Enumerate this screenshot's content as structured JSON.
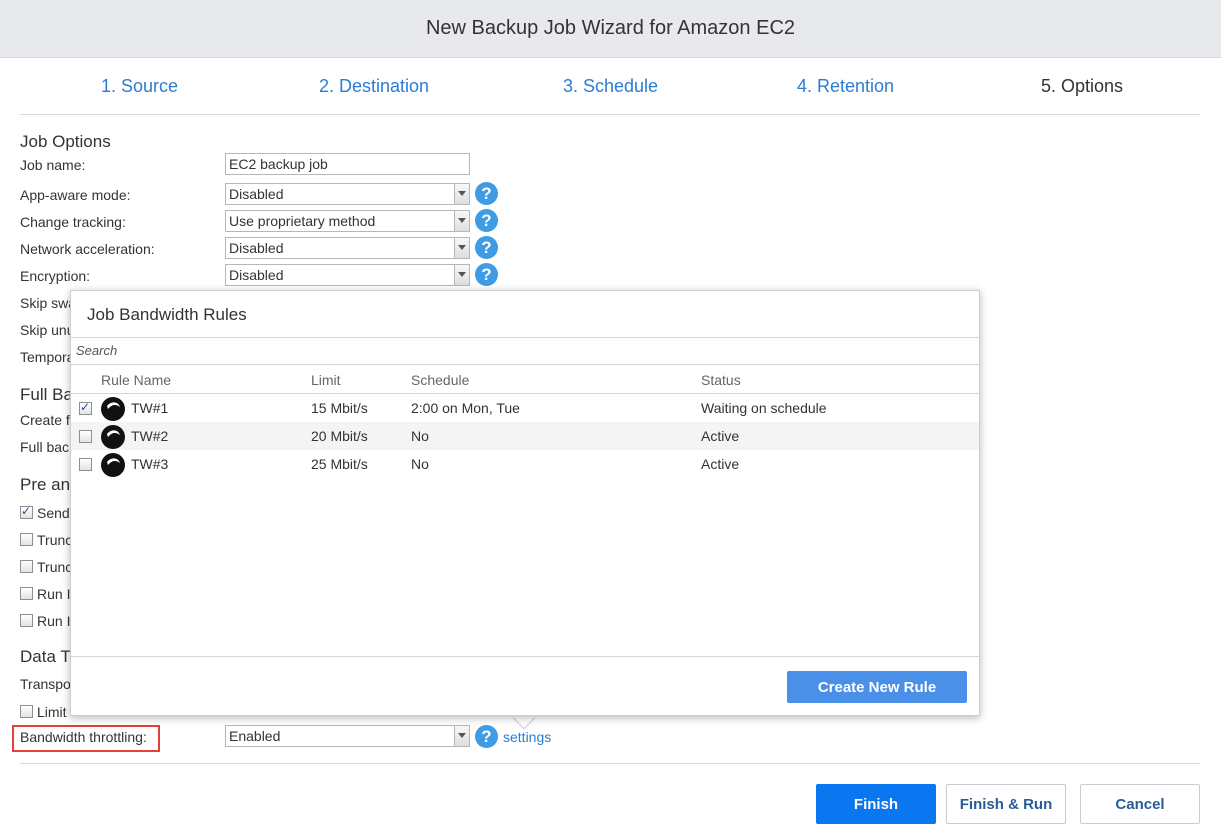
{
  "window": {
    "title": "New Backup Job Wizard for Amazon EC2"
  },
  "steps": [
    "1. Source",
    "2. Destination",
    "3. Schedule",
    "4. Retention",
    "5. Options"
  ],
  "job_options": {
    "title": "Job Options",
    "job_name_label": "Job name:",
    "job_name_value": "EC2 backup job",
    "app_aware_label": "App-aware mode:",
    "app_aware_value": "Disabled",
    "change_tracking_label": "Change tracking:",
    "change_tracking_value": "Use proprietary method",
    "network_accel_label": "Network acceleration:",
    "network_accel_value": "Disabled",
    "encryption_label": "Encryption:",
    "encryption_value": "Disabled",
    "skip_swap_label": "Skip swa",
    "skip_unused_label": "Skip unu",
    "temporary_label": "Tempora"
  },
  "full_backup": {
    "title": "Full Ba",
    "create_label": "Create f",
    "full_backup_label": "Full bac"
  },
  "pre_post": {
    "title": "Pre an",
    "items": [
      {
        "label": "Send",
        "checked": true
      },
      {
        "label": "Trunc",
        "checked": false
      },
      {
        "label": "Trunc",
        "checked": false
      },
      {
        "label": "Run I",
        "checked": false
      },
      {
        "label": "Run I",
        "checked": false
      }
    ]
  },
  "data_transfer": {
    "title": "Data T",
    "transport_label": "Transpo",
    "limit_label": "Limit",
    "bandwidth_label": "Bandwidth throttling:",
    "bandwidth_value": "Enabled",
    "settings_link": "settings"
  },
  "popup": {
    "title": "Job Bandwidth Rules",
    "search_placeholder": "Search",
    "columns": [
      "Rule Name",
      "Limit",
      "Schedule",
      "Status"
    ],
    "rows": [
      {
        "checked": true,
        "name": "TW#1",
        "limit": "15 Mbit/s",
        "schedule": "2:00 on Mon, Tue",
        "status": "Waiting on schedule"
      },
      {
        "checked": false,
        "name": "TW#2",
        "limit": "20 Mbit/s",
        "schedule": "No",
        "status": "Active"
      },
      {
        "checked": false,
        "name": "TW#3",
        "limit": "25 Mbit/s",
        "schedule": "No",
        "status": "Active"
      }
    ],
    "create_button": "Create New Rule"
  },
  "footer": {
    "finish": "Finish",
    "finish_run": "Finish & Run",
    "cancel": "Cancel"
  },
  "icons": {
    "help": "help-icon",
    "rule": "bandwidth-rule-icon",
    "dropdown": "chevron-down-icon"
  },
  "colors": {
    "accent": "#2b7cd3",
    "primary_button": "#0a76f0",
    "help_icon": "#3f9be3",
    "highlight": "#e3403a"
  }
}
